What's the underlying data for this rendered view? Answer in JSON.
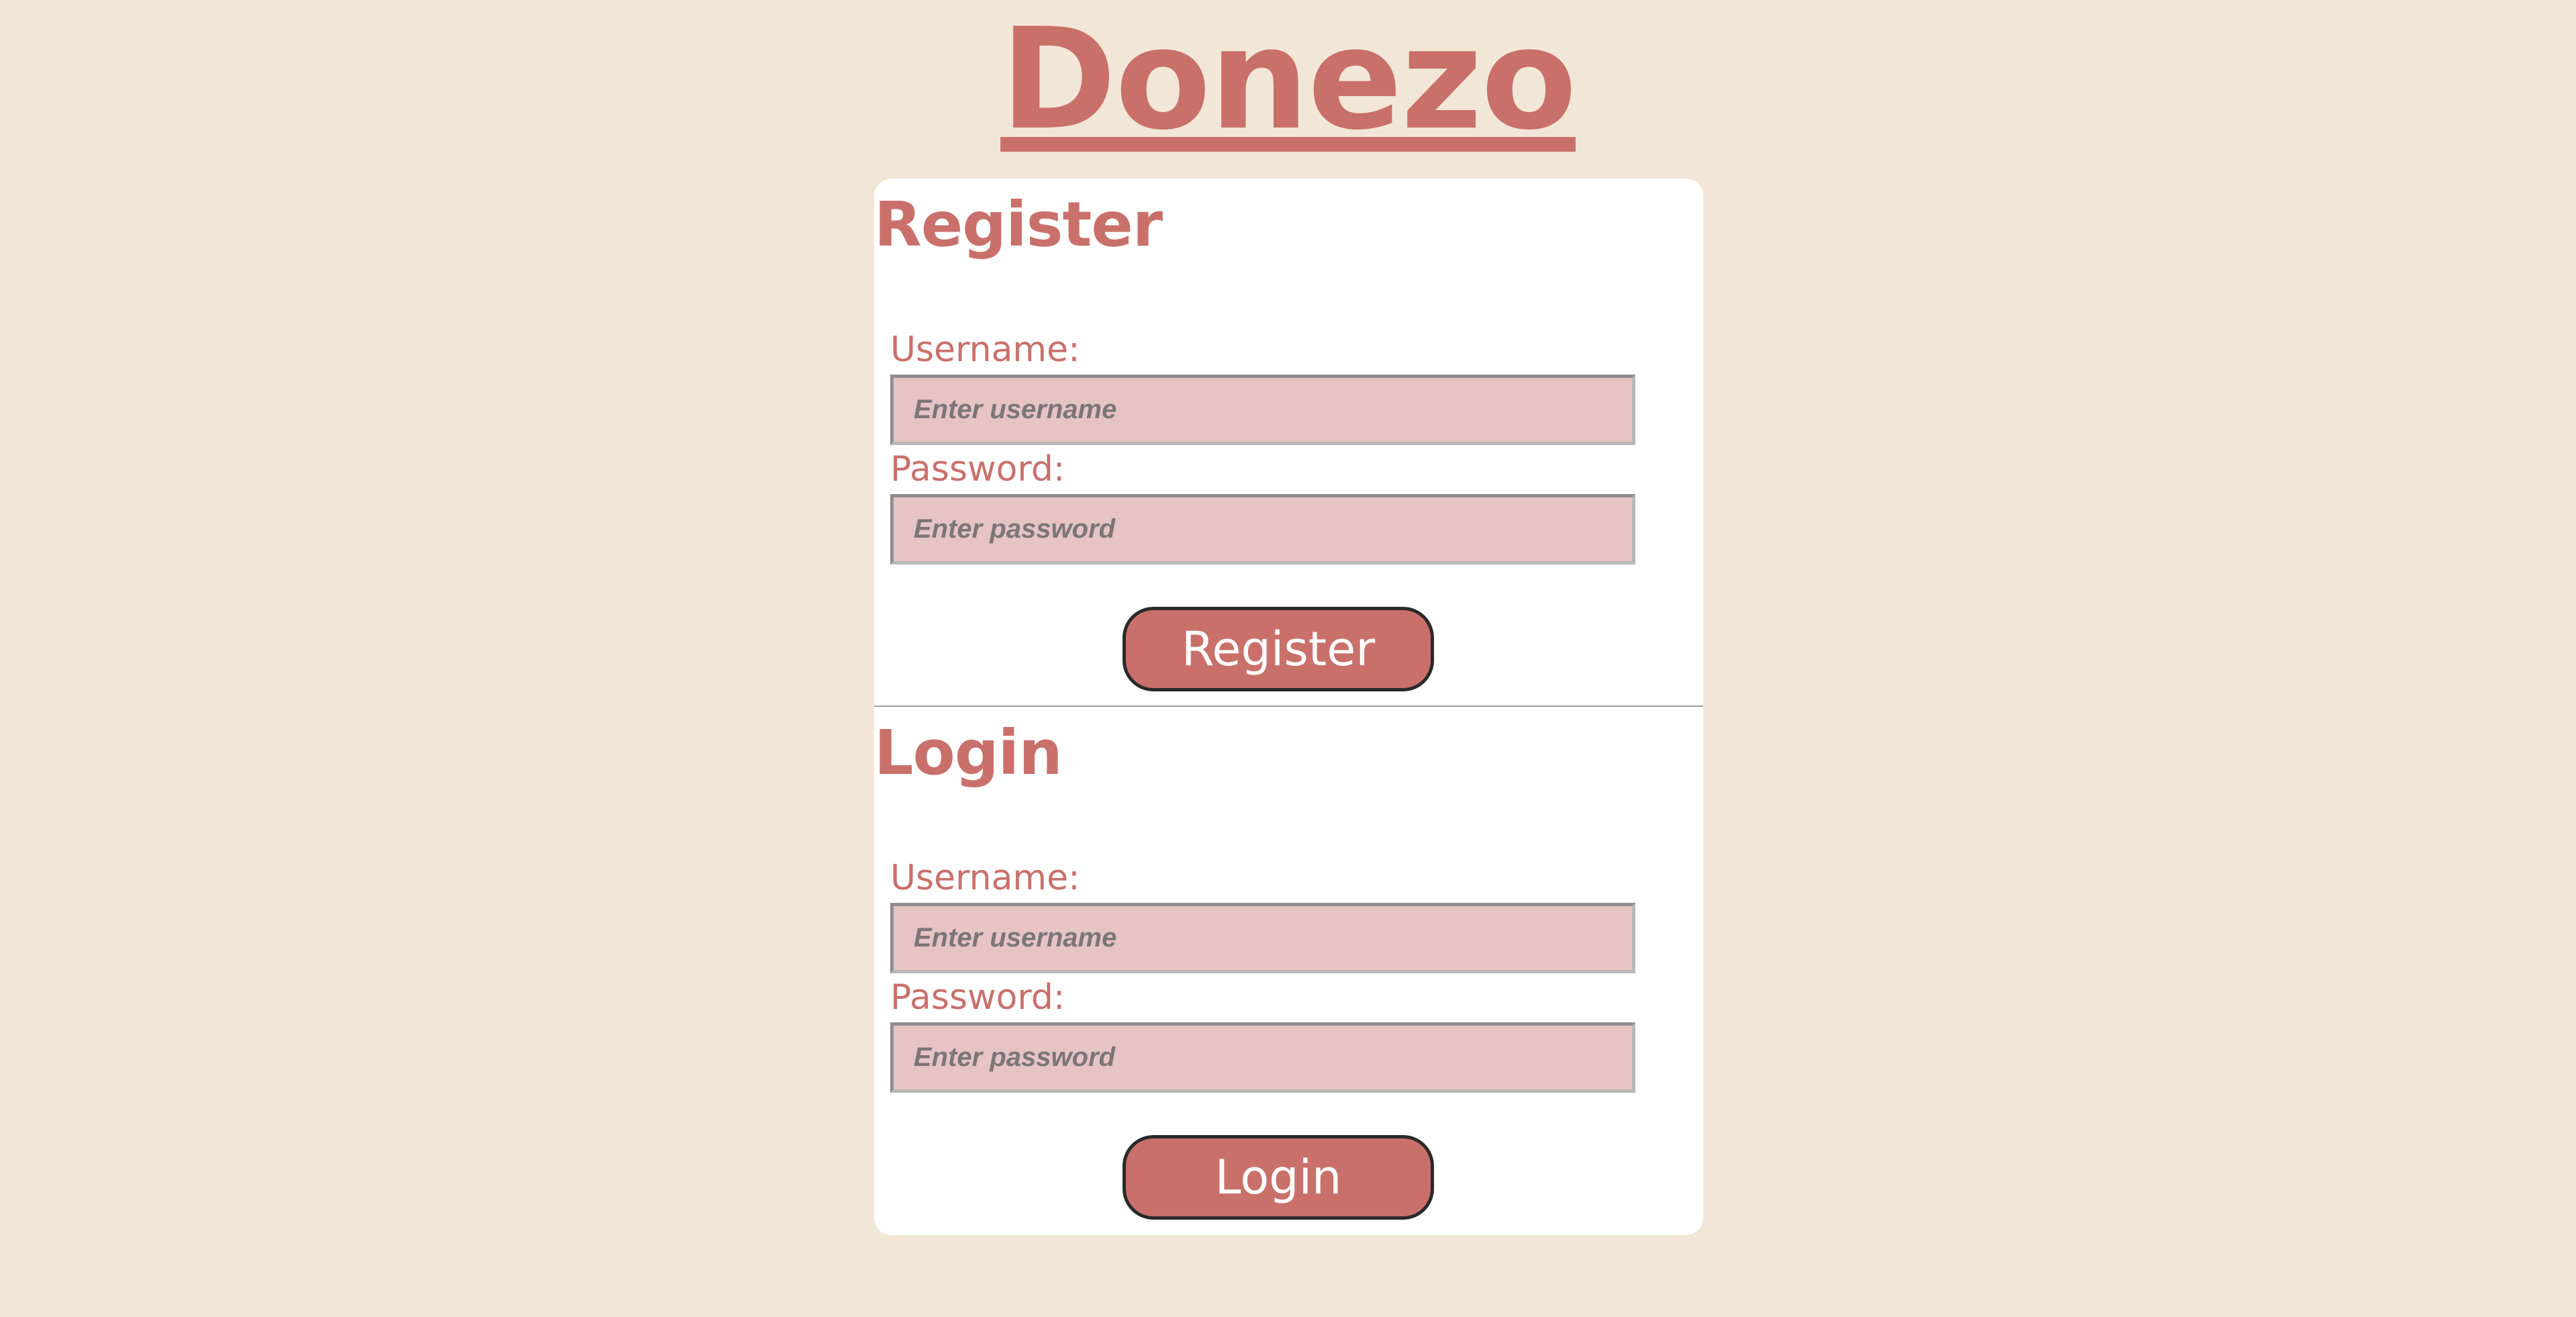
{
  "app": {
    "title": "Donezo"
  },
  "register": {
    "heading": "Register",
    "username_label": "Username:",
    "username_placeholder": "Enter username",
    "password_label": "Password:",
    "password_placeholder": "Enter password",
    "button_label": "Register"
  },
  "login": {
    "heading": "Login",
    "username_label": "Username:",
    "username_placeholder": "Enter username",
    "password_label": "Password:",
    "password_placeholder": "Enter password",
    "button_label": "Login"
  },
  "colors": {
    "page_background": "#f2e7d6",
    "accent": "#c9706b",
    "input_background": "#e6c4c3",
    "card_background": "#ffffff"
  }
}
